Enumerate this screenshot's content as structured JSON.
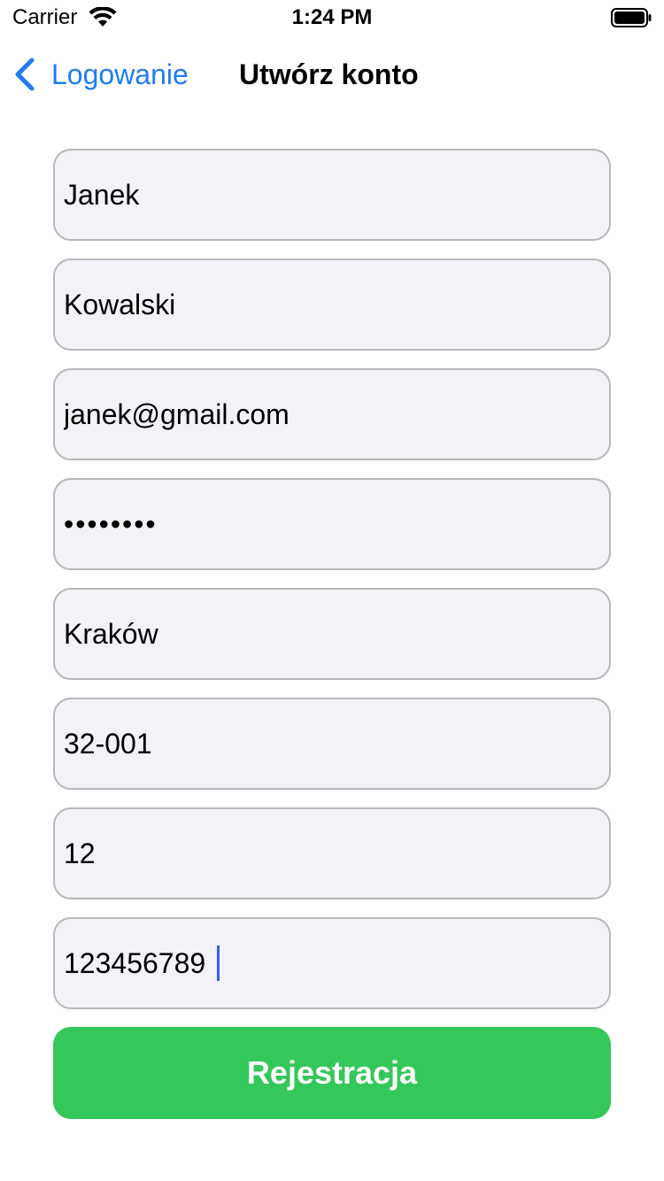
{
  "status_bar": {
    "carrier": "Carrier",
    "time": "1:24 PM",
    "wifi_icon": "wifi-icon",
    "battery_icon": "battery-full-icon"
  },
  "nav": {
    "back_label": "Logowanie",
    "title": "Utwórz konto",
    "back_icon": "chevron-left-icon"
  },
  "form": {
    "first_name": "Janek",
    "last_name": "Kowalski",
    "email": "janek@gmail.com",
    "password": "12345678",
    "city": "Kraków",
    "postal_code": "32-001",
    "house_number": "12",
    "phone": "123456789"
  },
  "actions": {
    "register_label": "Rejestracja"
  },
  "colors": {
    "accent": "#1f7cf0",
    "button": "#34c759",
    "field_background": "#f2f2f7",
    "field_border": "#b7b7bb",
    "caret": "#3b5ee6"
  }
}
